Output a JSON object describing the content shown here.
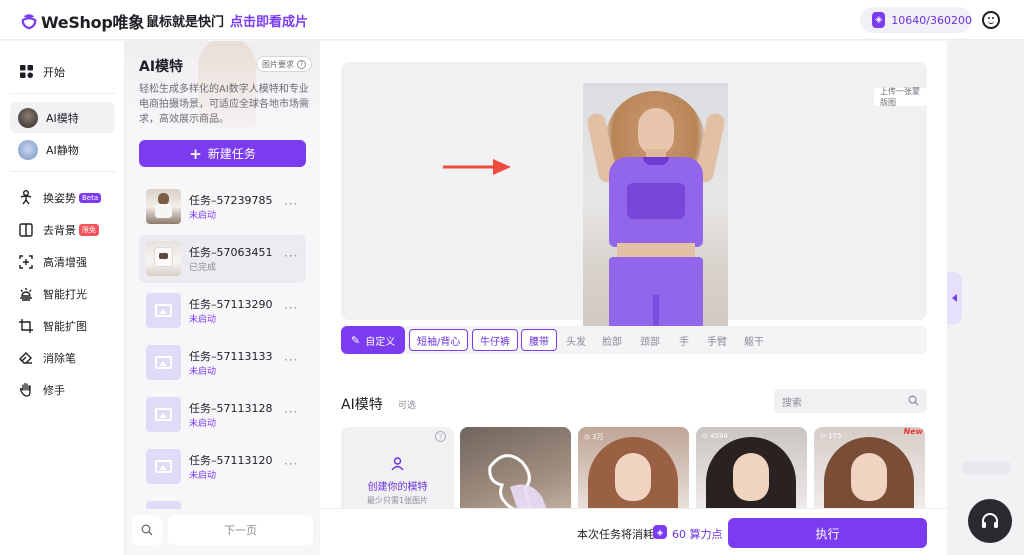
{
  "header": {
    "logo": "WeShop唯象",
    "slogan_main": "鼠标就是快门",
    "slogan_accent": "点击即看成片",
    "points": "10640/360200"
  },
  "sidebar": {
    "items": [
      {
        "label": "开始",
        "icon": "grid-icon"
      },
      {
        "label": "AI模特",
        "icon": "avatar-thumb",
        "active": true
      },
      {
        "label": "AI静物",
        "icon": "avatar-thumb"
      },
      {
        "label": "换姿势",
        "icon": "pose-icon",
        "badge": "Beta",
        "badge_color": "#7b3cf0"
      },
      {
        "label": "去背景",
        "icon": "book-icon",
        "badge": "限免",
        "badge_color": "#f2545b"
      },
      {
        "label": "高清增强",
        "icon": "enhance-icon"
      },
      {
        "label": "智能打光",
        "icon": "light-icon"
      },
      {
        "label": "智能扩图",
        "icon": "crop-icon"
      },
      {
        "label": "消除笔",
        "icon": "eraser-icon"
      },
      {
        "label": "修手",
        "icon": "hand-icon"
      }
    ]
  },
  "panel": {
    "title": "AI模特",
    "requirements": "图片要求",
    "description": "轻松生成多样化的AI数字人模特和专业电商拍摄场景，可适应全球各地市场需求，高效展示商品。",
    "new_task": "新建任务",
    "tasks": [
      {
        "name": "任务–57239785",
        "status": "未启动",
        "thumb": "photo"
      },
      {
        "name": "任务–57063451",
        "status": "已完成",
        "thumb": "photo",
        "selected": true
      },
      {
        "name": "任务–57113290",
        "status": "未启动",
        "thumb": "placeholder"
      },
      {
        "name": "任务–57113133",
        "status": "未启动",
        "thumb": "placeholder"
      },
      {
        "name": "任务–57113128",
        "status": "未启动",
        "thumb": "placeholder"
      },
      {
        "name": "任务–57113120",
        "status": "未启动",
        "thumb": "placeholder"
      }
    ],
    "next_page": "下一页"
  },
  "main": {
    "upload_mask": "上传一张蒙版图",
    "tags": {
      "custom": "自定义",
      "selected": [
        "短袖/背心",
        "牛仔裤",
        "腰带"
      ],
      "unselected": [
        "头发",
        "脸部",
        "颈部",
        "手",
        "手臂",
        "躯干"
      ]
    },
    "models_section": {
      "title": "AI模特",
      "subtitle": "可选",
      "search_placeholder": "搜索",
      "create_label": "创建你的模特",
      "create_hint": "最少只需1张图片",
      "help": "?",
      "cards": [
        {
          "count": "",
          "new": false
        },
        {
          "count": "3万",
          "new": false
        },
        {
          "count": "4594",
          "new": false
        },
        {
          "count": "175",
          "new": true
        }
      ],
      "new_tag": "New"
    },
    "footer": {
      "cost_label": "本次任务将消耗",
      "cost_value": "60 算力点",
      "run": "执行"
    }
  },
  "colors": {
    "accent": "#7b3cf0",
    "accent_text": "#6a32d9",
    "red": "#f2545b"
  }
}
